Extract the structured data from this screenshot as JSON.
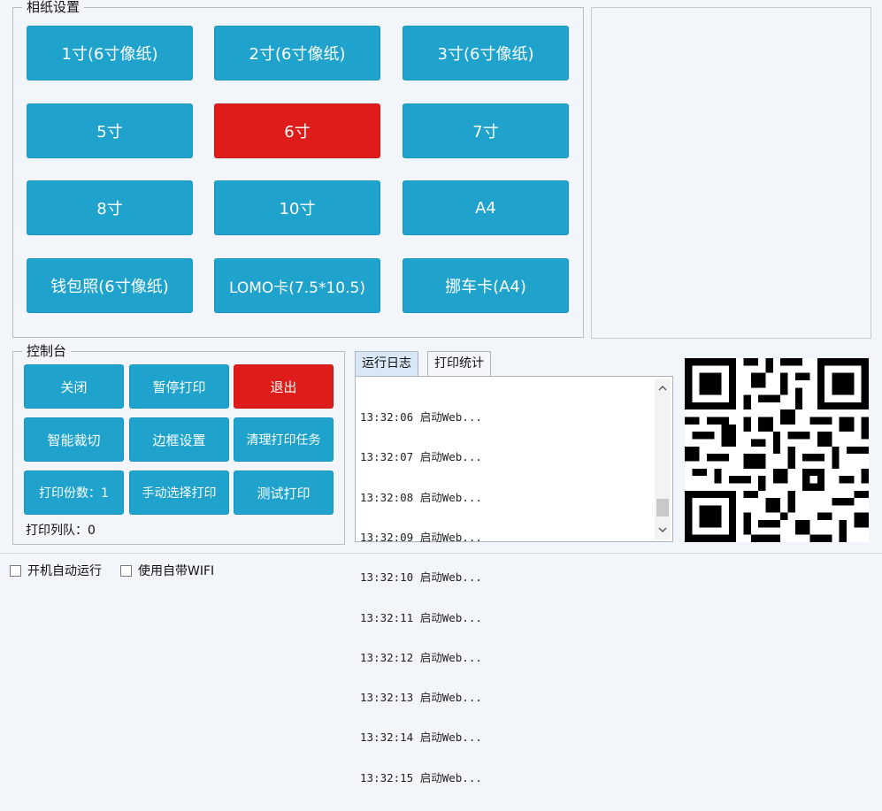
{
  "paper_settings": {
    "title": "相纸设置",
    "buttons": [
      {
        "label": "1寸(6寸像纸)",
        "selected": false
      },
      {
        "label": "2寸(6寸像纸)",
        "selected": false
      },
      {
        "label": "3寸(6寸像纸)",
        "selected": false
      },
      {
        "label": "5寸",
        "selected": false
      },
      {
        "label": "6寸",
        "selected": true
      },
      {
        "label": "7寸",
        "selected": false
      },
      {
        "label": "8寸",
        "selected": false
      },
      {
        "label": "10寸",
        "selected": false
      },
      {
        "label": "A4",
        "selected": false
      },
      {
        "label": "钱包照(6寸像纸)",
        "selected": false
      },
      {
        "label": "LOMO卡(7.5*10.5)",
        "selected": false
      },
      {
        "label": "挪车卡(A4)",
        "selected": false
      }
    ]
  },
  "console": {
    "title": "控制台",
    "buttons": {
      "close": "关闭",
      "pause_print": "暂停打印",
      "exit": "退出",
      "smart_crop": "智能裁切",
      "border_settings": "边框设置",
      "clear_print_tasks": "清理打印任务",
      "print_copies": "打印份数：1",
      "manual_select_print": "手动选择打印",
      "test_print": "测试打印"
    },
    "print_queue": "打印列队：0"
  },
  "tabs": {
    "run_log": "运行日志",
    "print_stats": "打印统计"
  },
  "log_lines": [
    "13:32:06 启动Web...",
    "13:32:07 启动Web...",
    "13:32:08 启动Web...",
    "13:32:09 启动Web...",
    "13:32:10 启动Web...",
    "13:32:11 启动Web...",
    "13:32:12 启动Web...",
    "13:32:13 启动Web...",
    "13:32:14 启动Web...",
    "13:32:15 启动Web..."
  ],
  "options": {
    "auto_start": "开机自动运行",
    "builtin_wifi": "使用自带WIFI"
  },
  "colors": {
    "button_blue": "#1fa3cd",
    "button_red": "#de1d1a",
    "background": "#f2f5fa"
  }
}
